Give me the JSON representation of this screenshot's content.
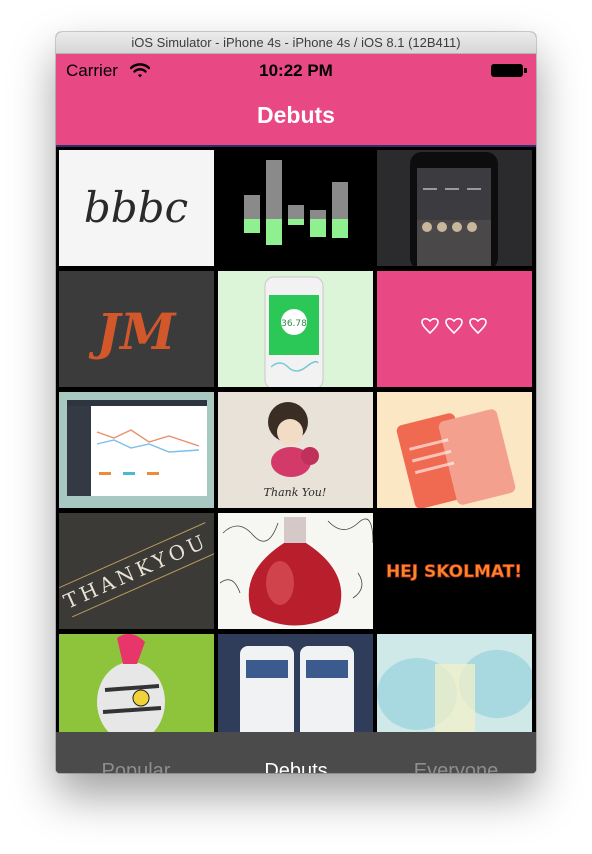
{
  "window": {
    "title": "iOS Simulator - iPhone 4s - iPhone 4s / iOS 8.1 (12B411)"
  },
  "status_bar": {
    "carrier": "Carrier",
    "time": "10:22 PM",
    "wifi_icon": "wifi-icon",
    "battery_icon": "battery-icon"
  },
  "nav": {
    "title": "Debuts"
  },
  "colors": {
    "brand": "#e84883",
    "tab_bar": "#4b4b4b",
    "tab_active": "#ffffff",
    "tab_inactive": "#8e8e8e"
  },
  "shots": {
    "bbbc": {
      "text": "bbbc"
    },
    "monogram": {
      "text": "JM"
    },
    "app": {
      "value": "36.78"
    },
    "thank_you_card": {
      "text": "Thank You!"
    },
    "thankyou_sign": {
      "text": "THANKYOU"
    },
    "hej_skolmat": {
      "text": "HEJ SKOLMAT!"
    }
  },
  "tabs": [
    {
      "label": "Popular",
      "active": false
    },
    {
      "label": "Debuts",
      "active": true
    },
    {
      "label": "Everyone",
      "active": false
    }
  ]
}
